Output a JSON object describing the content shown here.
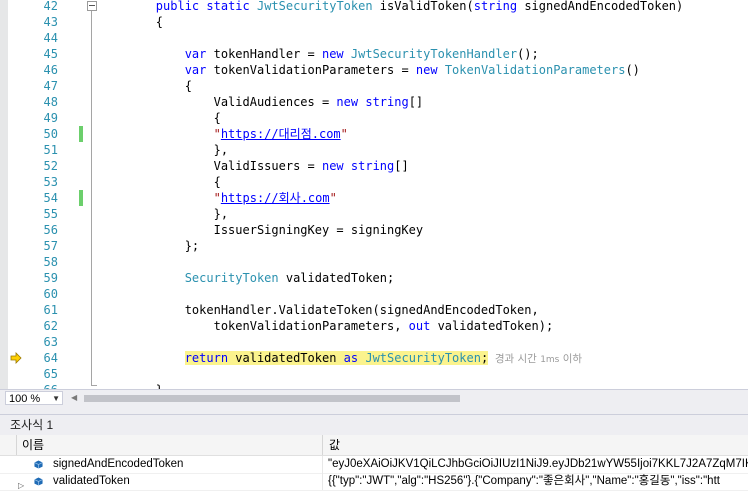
{
  "editor": {
    "lines": [
      {
        "num": "42",
        "tokens": [
          {
            "t": "        "
          },
          {
            "t": "public",
            "c": "kw"
          },
          {
            "t": " "
          },
          {
            "t": "static",
            "c": "kw"
          },
          {
            "t": " "
          },
          {
            "t": "JwtSecurityToken",
            "c": "ty"
          },
          {
            "t": " isValidToken("
          },
          {
            "t": "string",
            "c": "kw"
          },
          {
            "t": " signedAndEncodedToken)"
          }
        ]
      },
      {
        "num": "43",
        "tokens": [
          {
            "t": "        {"
          }
        ]
      },
      {
        "num": "44",
        "tokens": []
      },
      {
        "num": "45",
        "tokens": [
          {
            "t": "            "
          },
          {
            "t": "var",
            "c": "kw"
          },
          {
            "t": " tokenHandler = "
          },
          {
            "t": "new",
            "c": "kw"
          },
          {
            "t": " "
          },
          {
            "t": "JwtSecurityTokenHandler",
            "c": "ty"
          },
          {
            "t": "();"
          }
        ]
      },
      {
        "num": "46",
        "tokens": [
          {
            "t": "            "
          },
          {
            "t": "var",
            "c": "kw"
          },
          {
            "t": " tokenValidationParameters = "
          },
          {
            "t": "new",
            "c": "kw"
          },
          {
            "t": " "
          },
          {
            "t": "TokenValidationParameters",
            "c": "ty"
          },
          {
            "t": "()"
          }
        ]
      },
      {
        "num": "47",
        "tokens": [
          {
            "t": "            {"
          }
        ]
      },
      {
        "num": "48",
        "tokens": [
          {
            "t": "                ValidAudiences = "
          },
          {
            "t": "new",
            "c": "kw"
          },
          {
            "t": " "
          },
          {
            "t": "string",
            "c": "kw"
          },
          {
            "t": "[]"
          }
        ]
      },
      {
        "num": "49",
        "tokens": [
          {
            "t": "                {"
          }
        ]
      },
      {
        "num": "50",
        "changed": true,
        "tokens": [
          {
            "t": "                "
          },
          {
            "t": "\"",
            "c": "st"
          },
          {
            "t": "https://대리점.com",
            "c": "url"
          },
          {
            "t": "\"",
            "c": "st"
          }
        ]
      },
      {
        "num": "51",
        "tokens": [
          {
            "t": "                },"
          }
        ]
      },
      {
        "num": "52",
        "tokens": [
          {
            "t": "                ValidIssuers = "
          },
          {
            "t": "new",
            "c": "kw"
          },
          {
            "t": " "
          },
          {
            "t": "string",
            "c": "kw"
          },
          {
            "t": "[]"
          }
        ]
      },
      {
        "num": "53",
        "tokens": [
          {
            "t": "                {"
          }
        ]
      },
      {
        "num": "54",
        "changed": true,
        "tokens": [
          {
            "t": "                "
          },
          {
            "t": "\"",
            "c": "st"
          },
          {
            "t": "https://회사.com",
            "c": "url"
          },
          {
            "t": "\"",
            "c": "st"
          }
        ]
      },
      {
        "num": "55",
        "tokens": [
          {
            "t": "                },"
          }
        ]
      },
      {
        "num": "56",
        "tokens": [
          {
            "t": "                IssuerSigningKey = signingKey"
          }
        ]
      },
      {
        "num": "57",
        "tokens": [
          {
            "t": "            };"
          }
        ]
      },
      {
        "num": "58",
        "tokens": []
      },
      {
        "num": "59",
        "tokens": [
          {
            "t": "            "
          },
          {
            "t": "SecurityToken",
            "c": "ty"
          },
          {
            "t": " validatedToken;"
          }
        ]
      },
      {
        "num": "60",
        "tokens": []
      },
      {
        "num": "61",
        "tokens": [
          {
            "t": "            tokenHandler.ValidateToken(signedAndEncodedToken,"
          }
        ]
      },
      {
        "num": "62",
        "tokens": [
          {
            "t": "                tokenValidationParameters, "
          },
          {
            "t": "out",
            "c": "kw"
          },
          {
            "t": " validatedToken);"
          }
        ]
      },
      {
        "num": "63",
        "tokens": []
      },
      {
        "num": "64",
        "current": true,
        "tokens": [
          {
            "t": "            "
          },
          {
            "t": "return",
            "c": "kw",
            "h": true
          },
          {
            "t": " validatedToken ",
            "h": true
          },
          {
            "t": "as",
            "c": "kw",
            "h": true
          },
          {
            "t": " ",
            "h": true
          },
          {
            "t": "JwtSecurityToken",
            "c": "ty",
            "h": true
          },
          {
            "t": ";",
            "h": true
          }
        ],
        "note_main": "경과 시간",
        "note_small": "1ms",
        "note_end": "이하"
      },
      {
        "num": "65",
        "tokens": []
      },
      {
        "num": "66",
        "tokens": [
          {
            "t": "        }"
          }
        ]
      }
    ],
    "colors": {
      "changed_marker": "#6ccf6c",
      "keyword": "#0000ff",
      "type": "#2b91af",
      "string": "#a31515",
      "highlight": "#fbf38d",
      "line_number": "#2b91af"
    }
  },
  "statusbar": {
    "zoom": "100 %"
  },
  "watch": {
    "title": "조사식 1",
    "col_name": "이름",
    "col_value": "값",
    "rows": [
      {
        "expandable": false,
        "name": "signedAndEncodedToken",
        "value": "\"eyJ0eXAiOiJKV1QiLCJhbGciOiJIUzI1NiJ9.eyJDb21wYW55Ijoi7KKL7J2A7ZqM7IKsIi"
      },
      {
        "expandable": true,
        "name": "validatedToken",
        "value": "{{\"typ\":\"JWT\",\"alg\":\"HS256\"}.{\"Company\":\"좋은회사\",\"Name\":\"홍길동\",\"iss\":\"htt"
      }
    ]
  }
}
